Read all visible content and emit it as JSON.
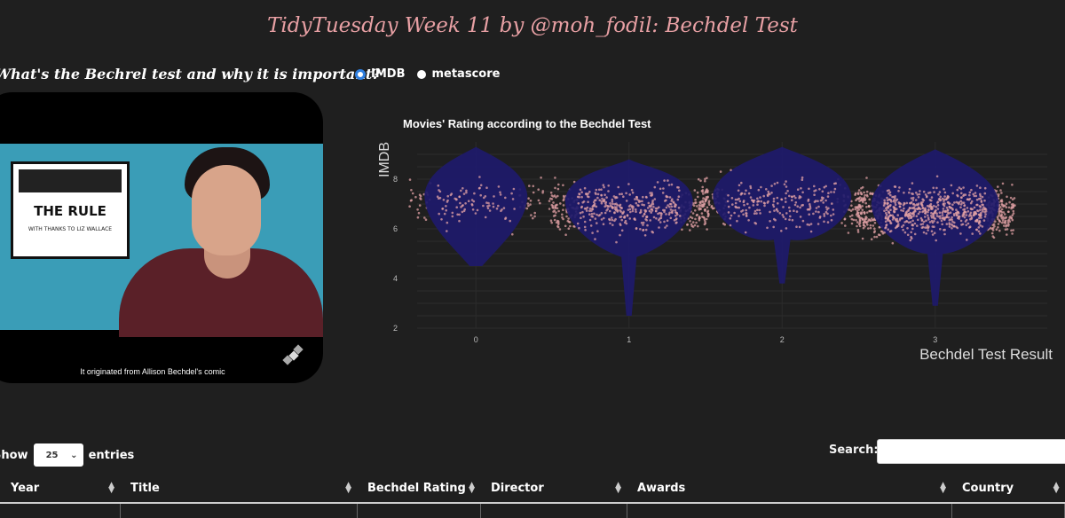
{
  "page": {
    "title": "TidyTuesday Week 11 by @moh_fodil: Bechdel Test",
    "question": "What's the Bechrel test and why it is important?"
  },
  "radios": [
    {
      "label": "IMDB",
      "selected": true
    },
    {
      "label": "metascore",
      "selected": false
    }
  ],
  "video": {
    "comic_title": "THE RULE",
    "comic_subtitle": "WITH THANKS TO LIZ WALLACE",
    "caption": "It originated from Allison Bechdel's comic",
    "logo_icon": "satellite-icon"
  },
  "chart_data": {
    "type": "violin",
    "title": "Movies' Rating according to the Bechdel Test",
    "xlabel": "Bechdel Test Result",
    "ylabel": "IMDB",
    "categories": [
      "0",
      "1",
      "2",
      "3"
    ],
    "y_ticks": [
      2,
      4,
      6,
      8
    ],
    "ylim": [
      2,
      9.5
    ],
    "violins": [
      {
        "category": "0",
        "min": 4.5,
        "max": 9.3,
        "median": 7.0
      },
      {
        "category": "1",
        "min": 2.5,
        "max": 8.8,
        "median": 6.8
      },
      {
        "category": "2",
        "min": 3.8,
        "max": 9.3,
        "median": 7.0
      },
      {
        "category": "3",
        "min": 2.9,
        "max": 9.2,
        "median": 6.7
      }
    ],
    "violin_color": "#1e1a6b",
    "point_color": "#e0a0a4",
    "grid": true
  },
  "table": {
    "show_label": "Show",
    "entries_label": "entries",
    "page_length": "25",
    "search_label": "Search:",
    "columns": [
      "Year",
      "Title",
      "Bechdel Rating",
      "Director",
      "Awards",
      "Country"
    ]
  }
}
